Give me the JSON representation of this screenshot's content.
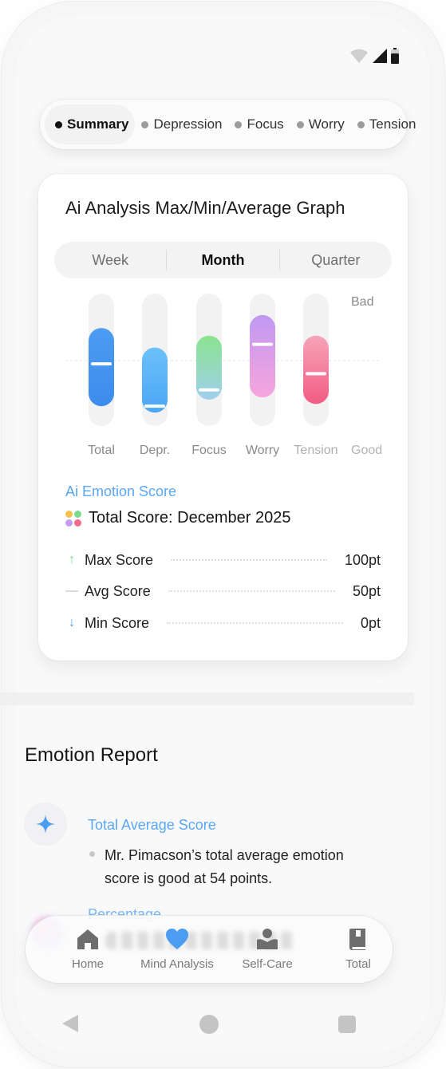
{
  "tabs": [
    {
      "label": "Summary",
      "active": true
    },
    {
      "label": "Depression",
      "active": false
    },
    {
      "label": "Focus",
      "active": false
    },
    {
      "label": "Worry",
      "active": false
    },
    {
      "label": "Tension",
      "active": false
    }
  ],
  "card": {
    "title": "Ai Analysis Max/Min/Average Graph",
    "periods": [
      "Week",
      "Month",
      "Quarter"
    ],
    "active_period": "Month"
  },
  "chart_data": {
    "type": "bar",
    "title": "Ai Analysis Max/Min/Average Graph",
    "scale_top_label": "Bad",
    "scale_bottom_label": "Good",
    "categories": [
      "Total",
      "Depr.",
      "Focus",
      "Worry",
      "Tension"
    ],
    "series": [
      {
        "name": "Max",
        "values": [
          80,
          62,
          73,
          92,
          73
        ]
      },
      {
        "name": "Average",
        "values": [
          47,
          8,
          23,
          65,
          38
        ]
      },
      {
        "name": "Min",
        "values": [
          8,
          2,
          14,
          16,
          10
        ]
      }
    ],
    "colors": [
      "#3f93f0",
      "#5bb4f7",
      "#7cd88a",
      "#c59cf2",
      "#f36a8d"
    ],
    "ylim": [
      0,
      100
    ],
    "midline": 50
  },
  "score": {
    "title": "Ai Emotion Score",
    "subtitle": "Total Score: December 2025",
    "rows": [
      {
        "icon": "arrow-up-icon",
        "label": "Max Score",
        "value": "100pt"
      },
      {
        "icon": "dash-icon",
        "label": "Avg Score",
        "value": "50pt"
      },
      {
        "icon": "arrow-down-icon",
        "label": "Min Score",
        "value": "0pt"
      }
    ]
  },
  "report": {
    "section_title": "Emotion Report",
    "items": [
      {
        "heading": "Total Average Score",
        "text": "Mr. Pimacson’s total average emotion score is good at 54 points."
      },
      {
        "heading": "Percentage"
      }
    ]
  },
  "nav": {
    "items": [
      {
        "label": "Home",
        "icon": "home-icon"
      },
      {
        "label": "Mind Analysis",
        "icon": "heart-icon",
        "active": true
      },
      {
        "label": "Self-Care",
        "icon": "self-care-icon"
      },
      {
        "label": "Total",
        "icon": "book-icon"
      }
    ]
  },
  "theme": {
    "accent": "#4b9df2",
    "label_blue": "#5aa7f2"
  }
}
